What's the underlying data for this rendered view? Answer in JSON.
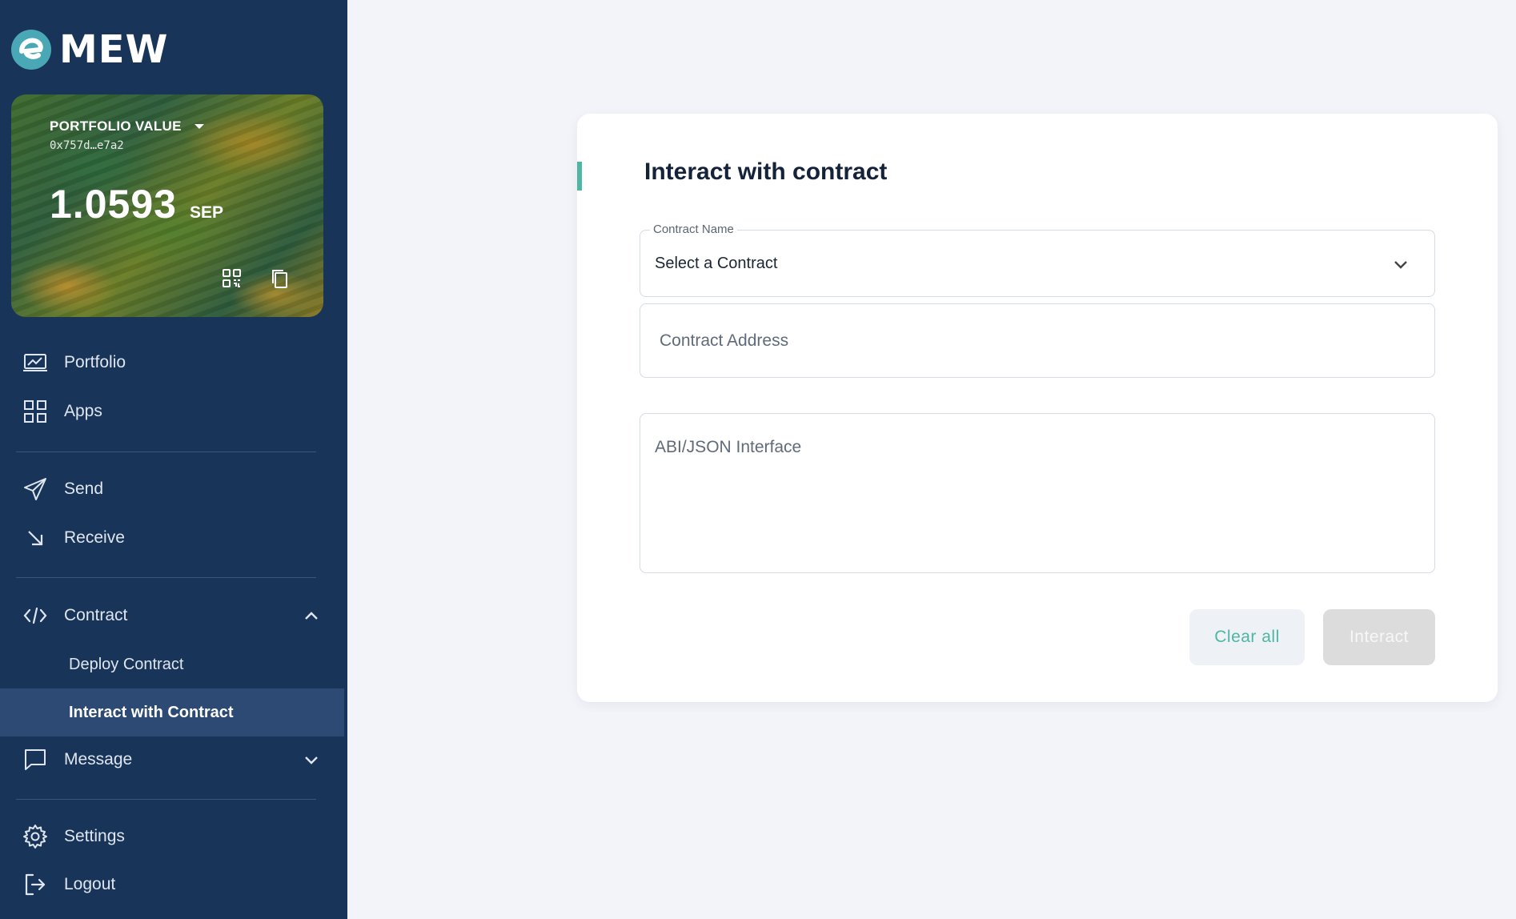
{
  "app": {
    "brand": "MEW"
  },
  "wallet": {
    "portfolio_label": "PORTFOLIO VALUE",
    "address": "0x757d…e7a2",
    "balance": "1.0593",
    "unit": "SEP"
  },
  "sidebar": {
    "items": [
      {
        "label": "Portfolio",
        "icon": "portfolio-icon"
      },
      {
        "label": "Apps",
        "icon": "apps-grid-icon"
      },
      {
        "label": "Send",
        "icon": "send-icon"
      },
      {
        "label": "Receive",
        "icon": "receive-icon"
      },
      {
        "label": "Contract",
        "icon": "code-icon",
        "expanded": true
      },
      {
        "label": "Message",
        "icon": "message-icon",
        "expanded": false
      },
      {
        "label": "Settings",
        "icon": "gear-icon"
      },
      {
        "label": "Logout",
        "icon": "logout-icon"
      }
    ],
    "contract_sub": [
      {
        "label": "Deploy Contract",
        "active": false
      },
      {
        "label": "Interact with Contract",
        "active": true
      }
    ]
  },
  "main": {
    "title": "Interact with contract",
    "contract_name_label": "Contract Name",
    "contract_name_value": "Select a Contract",
    "contract_address_placeholder": "Contract Address",
    "abi_placeholder": "ABI/JSON Interface",
    "clear_label": "Clear all",
    "interact_label": "Interact"
  },
  "colors": {
    "sidebar_bg": "#183458",
    "accent": "#4fb6a4",
    "page_bg": "#f2f4f9"
  }
}
